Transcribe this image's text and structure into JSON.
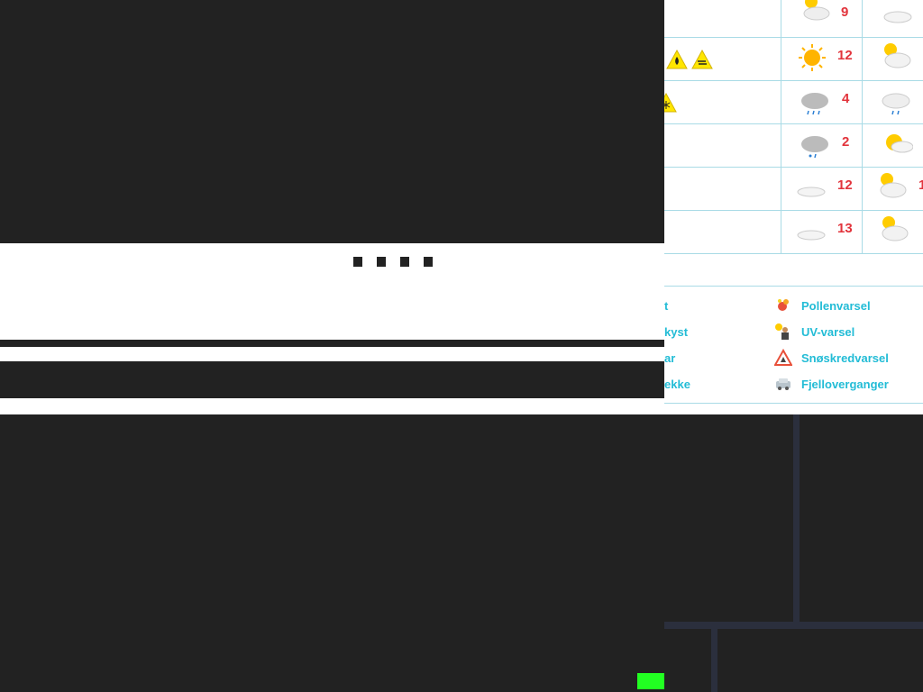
{
  "colors": {
    "overlay": "#222222",
    "temp_red": "#e2343c",
    "link_cyan": "#22bcd6",
    "grid_line": "#a9dbe6",
    "accent_green": "#22ff22"
  },
  "forecast": {
    "rows": [
      {
        "temp": "9",
        "icon_a": "partly-cloudy-icon",
        "icon_b": "cloud-icon"
      },
      {
        "temp": "12",
        "icon_a": "sun-icon",
        "icon_b": "partly-cloudy-icon",
        "warnings": [
          "fire-warning-icon",
          "wind-warning-icon"
        ]
      },
      {
        "temp": "4",
        "icon_a": "rain-cloud-icon",
        "icon_b": "rain-cloud-icon",
        "warnings": [
          "snow-warning-icon"
        ]
      },
      {
        "temp": "2",
        "icon_a": "sleet-cloud-icon",
        "icon_b": "partly-sunny-icon"
      },
      {
        "temp": "12",
        "icon_a": "cloud-icon",
        "icon_b": "partly-cloudy-icon"
      },
      {
        "temp": "13",
        "icon_a": "cloud-icon",
        "icon_b": "partly-cloudy-icon"
      }
    ]
  },
  "links": {
    "left": [
      "t",
      "kyst",
      "ar",
      "ekke"
    ],
    "right": [
      "Pollenvarsel",
      "UV-varsel",
      "Snøskredvarsel",
      "Fjelloverganger"
    ]
  }
}
